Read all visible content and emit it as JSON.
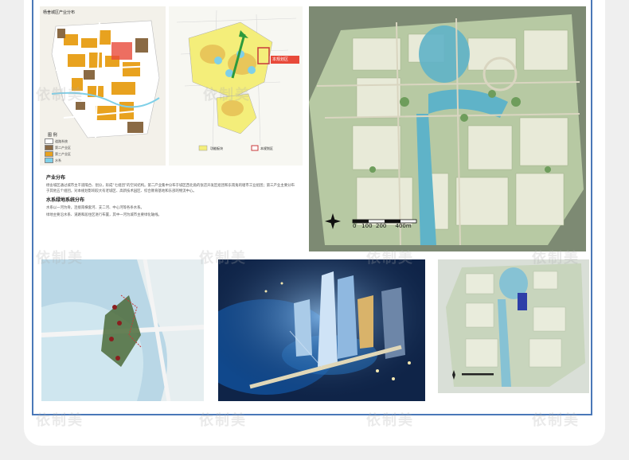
{
  "map1": {
    "title": "杨舍城区产业分布",
    "legend_title": "图 例",
    "legend": [
      {
        "label": "道路系统",
        "color": "#ffffff"
      },
      {
        "label": "第二产业区",
        "color": "#8a6a44"
      },
      {
        "label": "第三产业区",
        "color": "#e8a21f"
      },
      {
        "label": "水系",
        "color": "#7fd0e8"
      }
    ]
  },
  "map2": {
    "callout": "本规划区",
    "legend": [
      {
        "label": "功能板块",
        "color": "#f4ee7a"
      },
      {
        "label": "本规划区",
        "color": "#c83a3a"
      }
    ]
  },
  "text": {
    "heading1": "产业分布",
    "para1": "杨舍城区通过城市主干道隔合、划分，形成“七组团”的空间结构。第二产业集中分布于城区西北角的张店开发区组团和东南角的塘市工业组团；第三产业主要分布于其他五个组团，对本规划影响较大有老城区、高新技术园区、综合教育基地和东部的物流中心。",
    "heading2": "水系绿地系统分布",
    "para2": "水系以一河为骨，连接南横套河、支二河、中心河等各条水系。",
    "para3": "绿地主要沿水系、道路和居住区进行布置，其中一河为城市主要绿化轴线。"
  },
  "aerial": {
    "scale_labels": [
      "0",
      "100",
      "200",
      "400m"
    ]
  },
  "watermark": "依制美"
}
